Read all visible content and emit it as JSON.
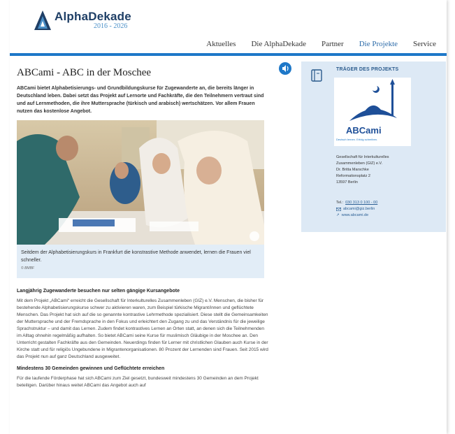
{
  "brand": {
    "name_bold": "Alpha",
    "name_regular": "Dekade",
    "years": "2016 - 2026",
    "primary_color": "#1f3f66",
    "accent_color": "#1e78c8"
  },
  "nav": {
    "items": [
      "Aktuelles",
      "Die AlphaDekade",
      "Partner",
      "Die Projekte",
      "Service"
    ],
    "active": "Die Projekte"
  },
  "article": {
    "title": "ABCami - ABC in der Moschee",
    "lead": "ABCami bietet Alphabetisierungs- und Grundbildungskurse für Zugewanderte an, die bereits länger in Deutschland leben. Dabei setzt das Projekt auf Lernorte und Fachkräfte, die den Teilnehmern vertraut sind und auf Lernmethoden, die ihre Muttersprache (türkisch und arabisch) wertschätzen. Vor allem Frauen nutzen das kostenlose Angebot.",
    "caption": "Seitdem der Alphabetisierungskurs in Frankfurt die konstrastive Methode anwendet, lernen die Frauen viel schneller.",
    "credit": "© BMBF",
    "heading1": "Langjährig Zugewanderte besuchen nur selten gängige Kursangebote",
    "paragraph1": "Mit dem Projekt „ABCami“ erreicht die Gesellschaft für Interkulturelles Zusammenleben (GIZ) e.V. Menschen, die bisher für bestehende Alphabetisierungskurse schwer zu aktivieren waren, zum Beispiel türkische Migrant/innen und geflüchtete Menschen. Das Projekt hat sich auf die so genannte kontrastive Lehrmethode spezialisiert. Diese stellt die Gemeinsamkeiten der Muttersprache und der Fremdsprache in den Fokus und erleichtert den Zugang zu und das Verständnis für die jeweilige Sprachstruktur – und damit das Lernen. Zudem findet kontrastives Lernen an Orten statt, an denen sich die Teilnehmenden im Alltag ohnehin regelmäßig aufhalten. So bietet ABCami seine Kurse für muslimisch Gläubige in der Moschee an. Den Unterricht gestalten Fachkräfte aus den Gemeinden. Neuerdings finden für Lerner mit christlichen Glauben auch Kurse in der Kirche statt und für religiös Ungebundene in Migrantenorganisationen. 80 Prozent der Lernenden sind Frauen. Seit 2015 wird das Projekt nun auf ganz Deutschland ausgeweitet.",
    "heading2": "Mindestens 30 Gemeinden gewinnen und Geflüchtete erreichen",
    "paragraph2": "Für die laufende Förderphase hat sich ABCami zum Ziel gesetzt, bundesweit mindestens 30 Gemeinden an dem Projekt beteiligen. Darüber hinaus weitet ABCami das Angebot auch auf"
  },
  "sidebar": {
    "title": "TRÄGER DES PROJEKTS",
    "logo_text": "ABCami",
    "logo_tagline": "Deutsch lernen. Erfolg schreiben.",
    "address_lines": [
      "Gesellschaft für Interkulturelles",
      "Zusammenleben (GIZ) e.V.",
      "Dr. Britta Marschke",
      "Reformationsplatz 2",
      "13597 Berlin"
    ],
    "tel_label": "Tel.:",
    "tel": "030 313 0 100 - 00",
    "email": "abcami@giz.berlin",
    "website": "www.abcami.de"
  }
}
